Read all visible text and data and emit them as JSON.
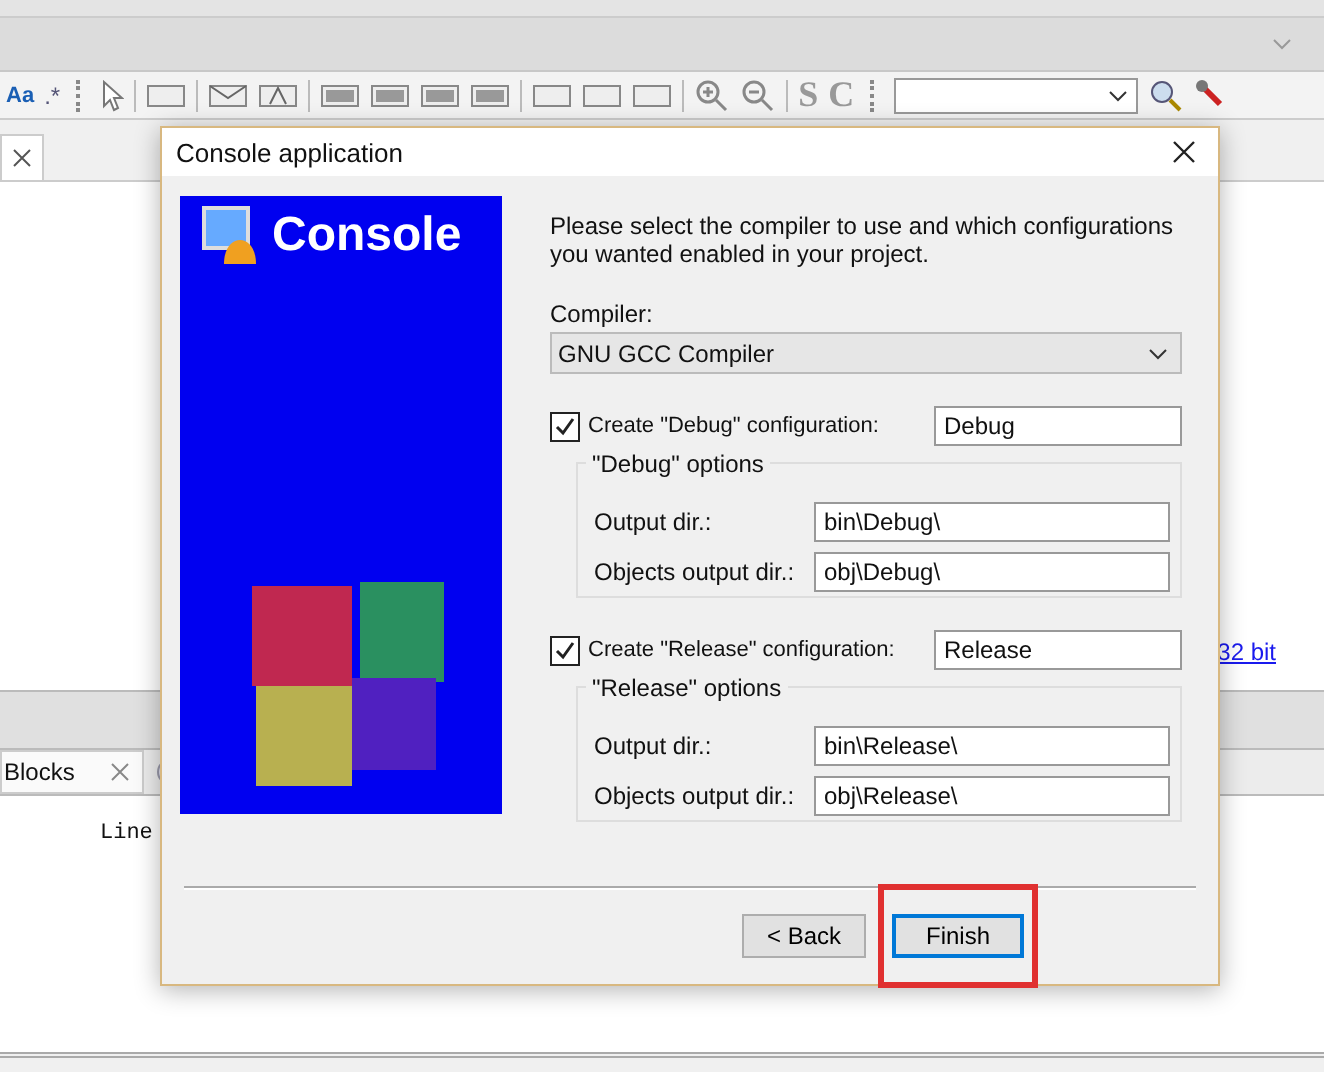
{
  "ide": {
    "toolbar_glyphs": [
      "Aa",
      ".*",
      "S",
      "C"
    ],
    "link": "32 bit",
    "bottom_tabs": [
      {
        "label": "Blocks",
        "selected": true
      }
    ],
    "log_text": "Line"
  },
  "dialog": {
    "title": "Console application",
    "banner_title": "Console",
    "intro": "Please select the compiler to use and which configurations you wanted enabled in your project.",
    "compiler_label": "Compiler:",
    "compiler": "GNU GCC Compiler",
    "configs": [
      {
        "checkbox_label": "Create \"Debug\" configuration:",
        "checked": true,
        "name": "Debug",
        "group_title": "\"Debug\" options",
        "output_label": "Output dir.:",
        "output_dir": "bin\\Debug\\",
        "objects_label": "Objects output dir.:",
        "objects_dir": "obj\\Debug\\"
      },
      {
        "checkbox_label": "Create \"Release\" configuration:",
        "checked": true,
        "name": "Release",
        "group_title": "\"Release\" options",
        "output_label": "Output dir.:",
        "output_dir": "bin\\Release\\",
        "objects_label": "Objects output dir.:",
        "objects_dir": "obj\\Release\\"
      }
    ],
    "buttons": [
      {
        "label": "< Back",
        "selected": false,
        "highlighted": false
      },
      {
        "label": "Finish",
        "selected": true,
        "highlighted": true
      }
    ]
  }
}
